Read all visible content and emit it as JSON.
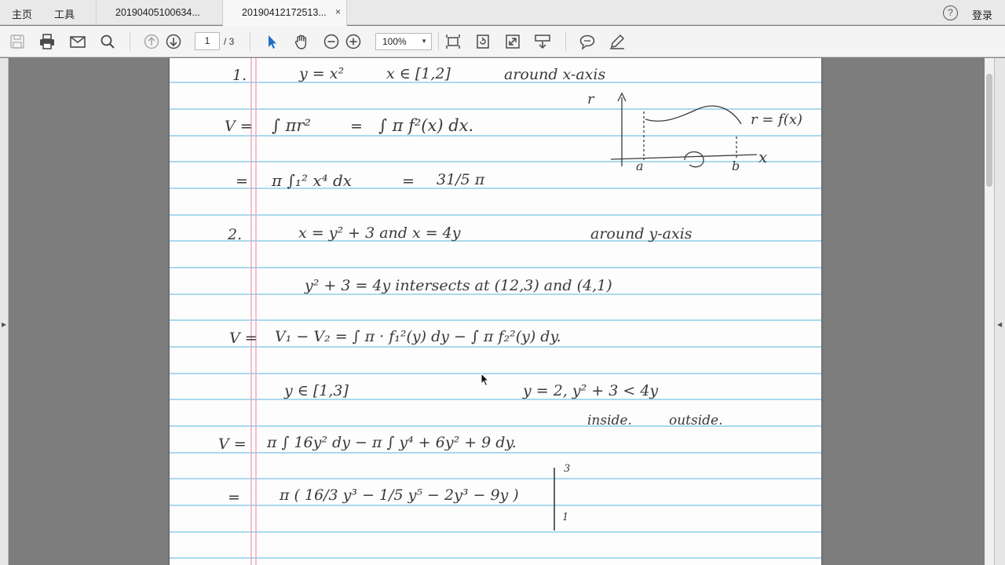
{
  "tabbar": {
    "home": "主页",
    "tools": "工具",
    "tabs": [
      {
        "label": "20190405100634..."
      },
      {
        "label": "20190412172513...",
        "close": "×"
      }
    ],
    "help": "?",
    "login": "登录"
  },
  "toolbar": {
    "page_current": "1",
    "page_total": "/ 3",
    "zoom": "100%"
  },
  "document": {
    "p1_num": "1.",
    "p1_eq": "y = x²",
    "p1_domain": "x ∈ [1,2]",
    "p1_around": "around  x-axis",
    "v1_lhs": "V =",
    "v1_expr": "∫ πr²",
    "v1_eq": "=",
    "v1_rhs": "∫ π  f²(x)  dx.",
    "graph_r": "r",
    "graph_fx": "r = f(x)",
    "graph_a": "a",
    "graph_b": "b",
    "graph_x": "x",
    "v2_eq": "=",
    "v2_expr": "π ∫₁² x⁴ dx",
    "v2_eq2": "=",
    "v2_rhs": "31/5 π",
    "p2_num": "2.",
    "p2_eq": "x = y² + 3   and   x = 4y",
    "p2_around": "around  y-axis",
    "p2_intersect": "y² + 3 = 4y    intersects  at   (12,3)  and  (4,1)",
    "p2_v_lhs": "V =",
    "p2_v_expr": "V₁ − V₂   =   ∫ π · f₁²(y) dy   − ∫ π f₂²(y) dy.",
    "p2_domain": "y ∈ [1,3]",
    "p2_test": "y = 2,    y² + 3  <  4y",
    "p2_inside": "inside.",
    "p2_outside": "outside.",
    "p2_v2_lhs": "V =",
    "p2_v2_expr": "π ∫  16y² dy   − π ∫   y⁴ + 6y² + 9 dy.",
    "p2_v3_eq": "=",
    "p2_v3_expr": "π   ( 16/3 y³  −  1/5 y⁵  −  2y³  −  9y )",
    "p2_upper": "3",
    "p2_lower": "1"
  },
  "colors": {
    "rule_line": "#8fcde8",
    "margin_line": "#f2a3b5",
    "ink": "#3a3a3a"
  }
}
